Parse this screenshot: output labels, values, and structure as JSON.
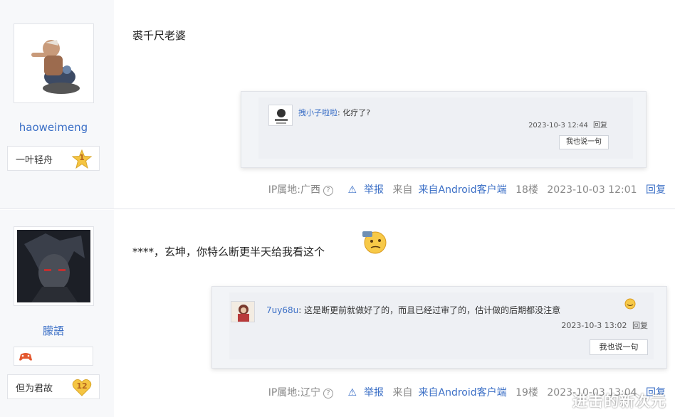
{
  "posts": [
    {
      "username": "haoweimeng",
      "badge": {
        "name": "一叶轻舟",
        "level": "1"
      },
      "content": "裘千尺老婆",
      "reply": {
        "user": "拽小子啦啦",
        "text": "化疗了?",
        "time": "2023-10-3 12:44",
        "reply_label": "回复",
        "say_button": "我也说一句"
      },
      "footer": {
        "ip": "IP属地:广西",
        "report": "举报",
        "client": "来自Android客户端",
        "floor": "18楼",
        "time": "2023-10-03 12:01",
        "reply_label": "回复"
      }
    },
    {
      "username": "朦語",
      "badge": {
        "name": "但为君故",
        "level": "12"
      },
      "content": "****，玄坤，你特么断更半天给我看这个",
      "reply": {
        "user": "7uy68u",
        "text": "这是断更前就做好了的，而且已经过审了的，估计做的后期都没注意",
        "time": "2023-10-3 13:02",
        "reply_label": "回复",
        "say_button": "我也说一句"
      },
      "footer": {
        "ip": "IP属地:辽宁",
        "report": "举报",
        "client": "来自Android客户端",
        "floor": "19楼",
        "time": "2023-10-03 13:04",
        "reply_label": "回复"
      }
    }
  ],
  "watermark": "进击的新次元",
  "colors": {
    "link": "#3b6fc6",
    "sidebar": "#f7f8fa",
    "badge": "#f5c542"
  },
  "icons": [
    "help-circle-icon",
    "warning-triangle-icon",
    "star-badge-icon",
    "heart-badge-icon",
    "gamepad-icon",
    "emoji-icon"
  ]
}
